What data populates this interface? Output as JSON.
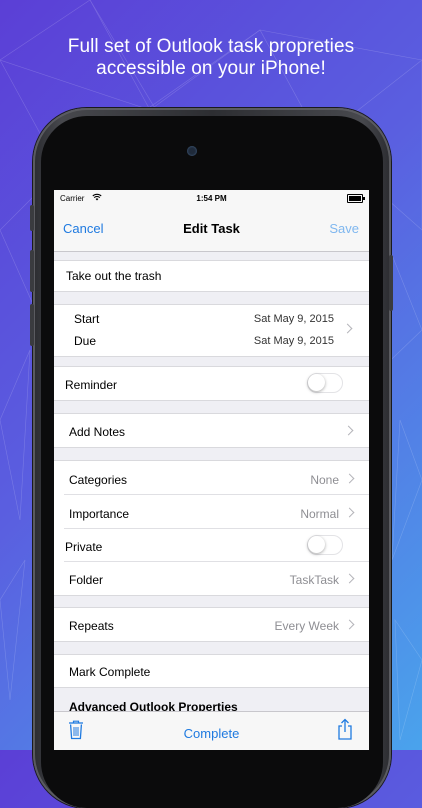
{
  "headline": {
    "line1": "Full set of Outlook task propreties",
    "line2": "accessible on your iPhone!"
  },
  "status_bar": {
    "carrier": "Carrier",
    "wifi_icon": "wifi-icon",
    "time": "1:54 PM",
    "battery_icon": "battery-icon"
  },
  "nav": {
    "cancel": "Cancel",
    "title": "Edit Task",
    "save": "Save"
  },
  "task": {
    "title": "Take out the trash"
  },
  "dates": {
    "start_label": "Start",
    "start_value": "Sat May 9, 2015",
    "due_label": "Due",
    "due_value": "Sat May 9, 2015"
  },
  "reminder": {
    "label": "Reminder",
    "on": false
  },
  "notes": {
    "label": "Add Notes"
  },
  "properties": {
    "categories_label": "Categories",
    "categories_value": "None",
    "importance_label": "Importance",
    "importance_value": "Normal",
    "private_label": "Private",
    "private_on": false,
    "folder_label": "Folder",
    "folder_value": "TaskTask"
  },
  "repeats": {
    "label": "Repeats",
    "value": "Every Week"
  },
  "mark_complete": {
    "label": "Mark Complete"
  },
  "advanced": {
    "label": "Advanced Outlook Properties"
  },
  "toolbar": {
    "complete": "Complete",
    "trash_icon": "trash-icon",
    "share_icon": "share-icon"
  },
  "colors": {
    "accent": "#1f7ae0",
    "save_disabled": "#7fb7ef",
    "secondary_text": "#8e8e93",
    "background": "#efeff4"
  }
}
